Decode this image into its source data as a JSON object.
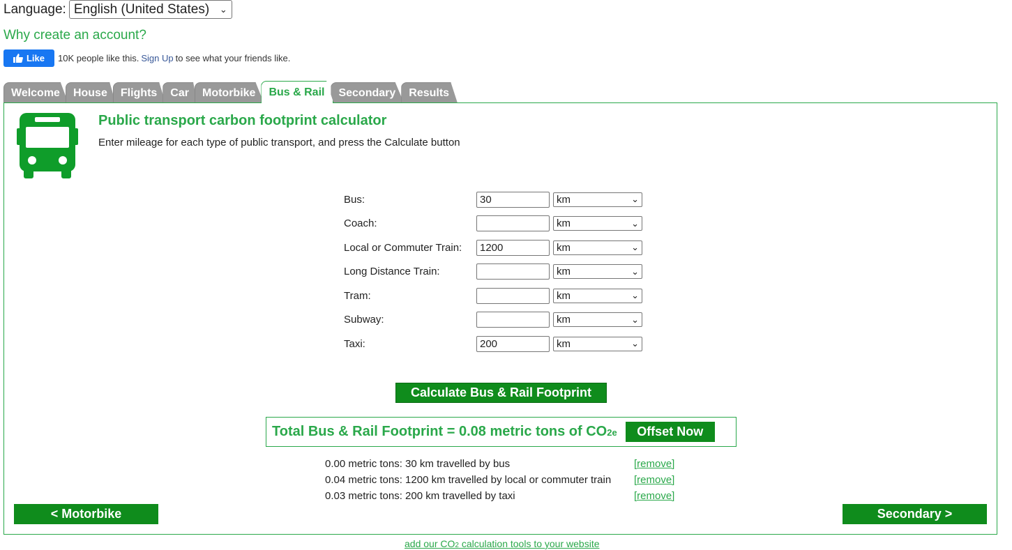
{
  "language": {
    "label": "Language:",
    "selected": "English (United States)"
  },
  "account_link": "Why create an account?",
  "facebook": {
    "button": "Like",
    "count_text": "10K people like this.",
    "signup": "Sign Up",
    "suffix": "to see what your friends like."
  },
  "tabs": [
    {
      "label": "Welcome",
      "active": false
    },
    {
      "label": "House",
      "active": false
    },
    {
      "label": "Flights",
      "active": false
    },
    {
      "label": "Car",
      "active": false
    },
    {
      "label": "Motorbike",
      "active": false
    },
    {
      "label": "Bus & Rail",
      "active": true
    },
    {
      "label": "Secondary",
      "active": false
    },
    {
      "label": "Results",
      "active": false
    }
  ],
  "panel": {
    "title": "Public transport carbon footprint calculator",
    "subtitle": "Enter mileage for each type of public transport, and press the Calculate button",
    "icon": "bus-icon",
    "fields": [
      {
        "label": "Bus:",
        "value": "30",
        "unit": "km"
      },
      {
        "label": "Coach:",
        "value": "",
        "unit": "km"
      },
      {
        "label": "Local or Commuter Train:",
        "value": "1200",
        "unit": "km"
      },
      {
        "label": "Long Distance Train:",
        "value": "",
        "unit": "km"
      },
      {
        "label": "Tram:",
        "value": "",
        "unit": "km"
      },
      {
        "label": "Subway:",
        "value": "",
        "unit": "km"
      },
      {
        "label": "Taxi:",
        "value": "200",
        "unit": "km"
      }
    ],
    "calculate_button": "Calculate Bus & Rail Footprint",
    "total": {
      "prefix": "Total Bus & Rail Footprint = 0.08 metric tons of CO",
      "sub": "2e",
      "offset_button": "Offset Now"
    },
    "results": [
      {
        "text": "0.00 metric tons: 30 km travelled by bus",
        "link": "[remove]"
      },
      {
        "text": "0.04 metric tons: 1200 km travelled by local or commuter train",
        "link": "[remove]"
      },
      {
        "text": "0.03 metric tons: 200 km travelled by taxi",
        "link": "[remove]"
      }
    ],
    "prev_button": "< Motorbike",
    "next_button": "Secondary >"
  },
  "footer": {
    "prefix": "add our CO",
    "sub": "2",
    "suffix": " calculation tools to your website"
  },
  "colors": {
    "brand_green": "#2aa84a",
    "button_green": "#0f8c1c",
    "tab_grey": "#999999",
    "facebook_blue": "#1877f2"
  }
}
